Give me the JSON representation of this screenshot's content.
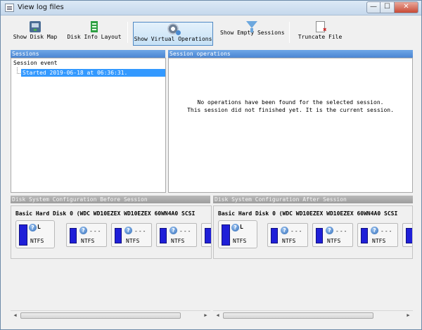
{
  "window": {
    "title": "View log files",
    "controls": {
      "minimize": "—",
      "maximize": "☐",
      "close": "✕"
    }
  },
  "toolbar": {
    "buttons": [
      {
        "label": "Show Disk Map",
        "icon": "disk-map-icon"
      },
      {
        "label": "Disk Info Layout",
        "icon": "disk-info-icon"
      },
      {
        "label": "Show Virtual Operations",
        "icon": "virtual-operations-icon",
        "active": true
      },
      {
        "label": "Show Empty Sessions",
        "icon": "filter-icon"
      },
      {
        "label": "Truncate File",
        "icon": "truncate-file-icon"
      }
    ]
  },
  "sessions": {
    "title": "Sessions",
    "column_header": "Session event",
    "items": [
      {
        "label": "Started 2019-06-18 at 06:36:31.",
        "selected": true
      }
    ]
  },
  "operations": {
    "title": "Session operations",
    "message_line1": "No operations have been found for the selected session.",
    "message_line2": "This session did not finished yet. It is the current session."
  },
  "before": {
    "title": "Disk System Configuration Before Session",
    "disk_label": "Basic Hard Disk 0 (WDC WD10EZEX WD10EZEX 60WN4A0 SCSI",
    "first_partition": {
      "mark": "L",
      "fs": "NTFS"
    },
    "partitions": [
      {
        "label": "---",
        "fs": "NTFS"
      },
      {
        "label": "---",
        "fs": "NTFS"
      },
      {
        "label": "---",
        "fs": "NTFS"
      }
    ]
  },
  "after": {
    "title": "Disk System Configuration After Session",
    "disk_label": "Basic Hard Disk 0 (WDC WD10EZEX WD10EZEX 60WN4A0 SCSI",
    "first_partition": {
      "mark": "L",
      "fs": "NTFS"
    },
    "partitions": [
      {
        "label": "---",
        "fs": "NTFS"
      },
      {
        "label": "---",
        "fs": "NTFS"
      },
      {
        "label": "---",
        "fs": "NTFS"
      }
    ]
  },
  "scrollbar": {
    "left_arrow": "◀",
    "right_arrow": "▶"
  },
  "colors": {
    "accent": "#4b86d3",
    "selection": "#3399ff",
    "partition_bar": "#1f1fd8"
  }
}
